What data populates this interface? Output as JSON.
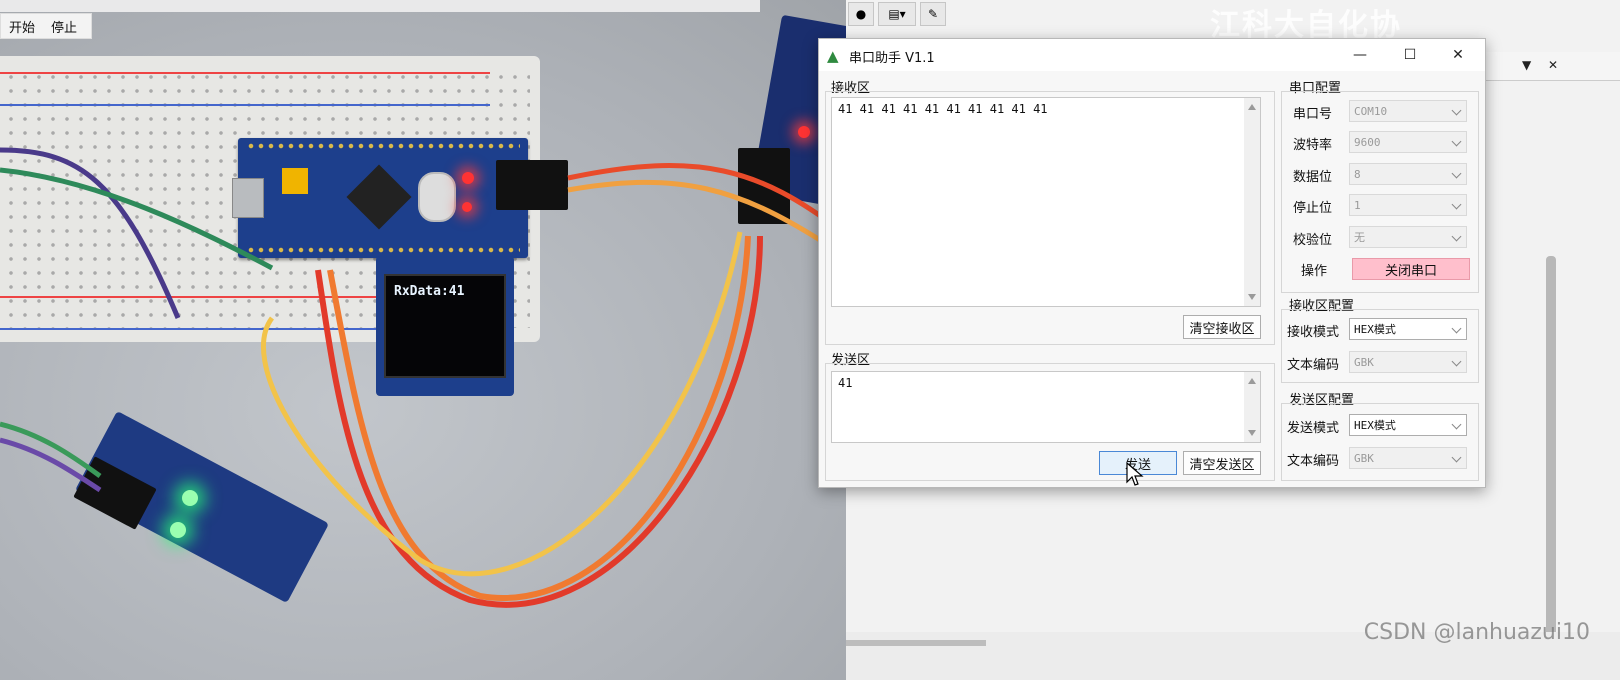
{
  "camera_app": {
    "menu": {
      "start": "开始",
      "stop": "停止"
    },
    "oled_text": "RxData:41"
  },
  "background_app": {
    "title_banner": "江科大自化协",
    "watermark": "CSDN @lanhuazui10",
    "panel_controls": {
      "dropdown": "▼",
      "close": "✕"
    }
  },
  "dialog": {
    "title": "串口助手 V1.1",
    "window_buttons": {
      "minimize": "—",
      "maximize": "☐",
      "close": "✕"
    },
    "receive": {
      "label": "接收区",
      "content": "41 41 41 41 41 41 41 41 41 41",
      "clear_button": "清空接收区"
    },
    "send": {
      "label": "发送区",
      "content": "41",
      "send_button": "发送",
      "clear_button": "清空发送区"
    },
    "port_config": {
      "label": "串口配置",
      "rows": [
        {
          "label": "串口号",
          "value": "COM10"
        },
        {
          "label": "波特率",
          "value": "9600"
        },
        {
          "label": "数据位",
          "value": "8"
        },
        {
          "label": "停止位",
          "value": "1"
        },
        {
          "label": "校验位",
          "value": "无"
        }
      ],
      "operation_label": "操作",
      "operation_button": "关闭串口"
    },
    "receive_config": {
      "label": "接收区配置",
      "mode_label": "接收模式",
      "mode_value": "HEX模式",
      "encoding_label": "文本编码",
      "encoding_value": "GBK"
    },
    "send_config": {
      "label": "发送区配置",
      "mode_label": "发送模式",
      "mode_value": "HEX模式",
      "encoding_label": "文本编码",
      "encoding_value": "GBK"
    }
  }
}
